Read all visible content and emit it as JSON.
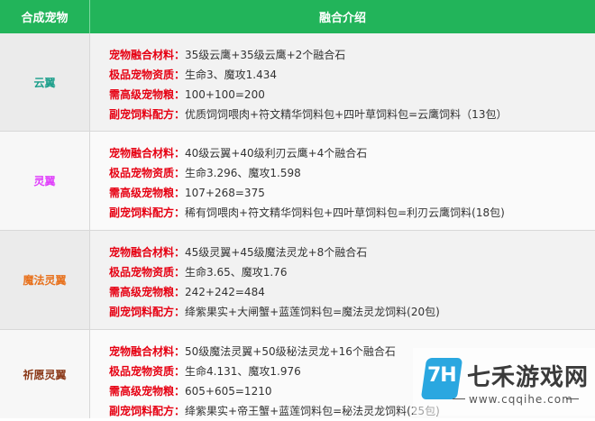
{
  "header": {
    "col_pet": "合成宠物",
    "col_intro": "融合介绍"
  },
  "labels": {
    "material": "宠物融合材料：",
    "aptitude": "极品宠物资质：",
    "food": "需高级宠物粮：",
    "recipe": "副宠饲料配方："
  },
  "colors": {
    "header_bg": "#22b45a",
    "label_red": "#e60012"
  },
  "rows": [
    {
      "name": "云翼",
      "name_color": "#1a9e8a",
      "material": "35级云鹰+35级云鹰+2个融合石",
      "aptitude": "生命3、魔攻1.434",
      "food": "100+100=200",
      "recipe": "优质饲饲喂肉+符文精华饲料包+四叶草饲料包=云鹰饲料（13包）"
    },
    {
      "name": "灵翼",
      "name_color": "#e040fb",
      "material": "40级云翼+40级利刃云鹰+4个融合石",
      "aptitude": "生命3.296、魔攻1.598",
      "food": "107+268=375",
      "recipe": "稀有饲喂肉+符文精华饲料包+四叶草饲料包=利刃云鹰饲料(18包)"
    },
    {
      "name": "魔法灵翼",
      "name_color": "#e8711c",
      "material": "45级灵翼+45级魔法灵龙+8个融合石",
      "aptitude": "生命3.65、魔攻1.76",
      "food": "242+242=484",
      "recipe": "绛紫果实+大闸蟹+蓝莲饲料包=魔法灵龙饲料(20包)"
    },
    {
      "name": "祈愿灵翼",
      "name_color": "#8b3a1a",
      "material": "50级魔法灵翼+50级秘法灵龙+16个融合石",
      "aptitude": "生命4.131、魔攻1.976",
      "food": "605+605=1210",
      "recipe": "绛紫果实+帝王蟹+蓝莲饲料包=秘法灵龙饲料(25包)"
    }
  ],
  "watermark": {
    "logo": "7H",
    "title": "七禾游戏网",
    "url": "www.cqqihe.com"
  }
}
